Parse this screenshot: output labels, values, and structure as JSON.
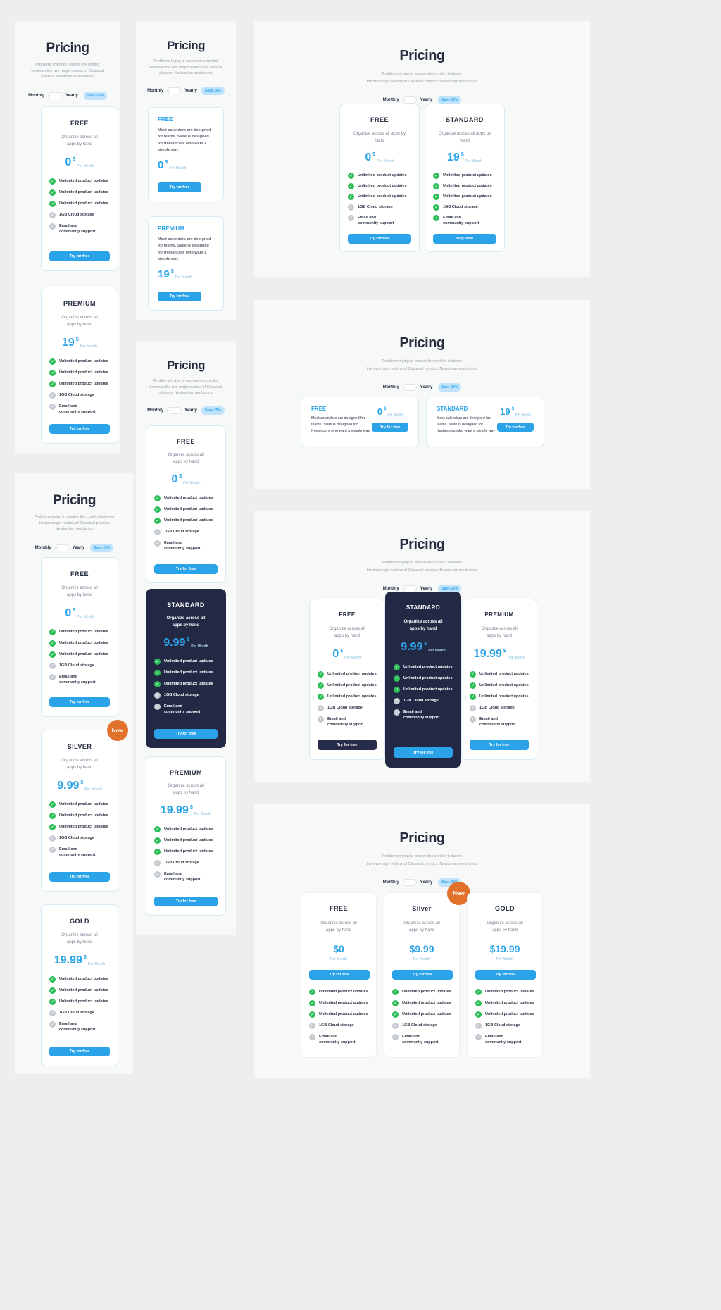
{
  "header": {
    "title": "Pricing",
    "subtitle_narrow": "Problems trying to resolve the conflict between the two major realms of Classical physics: Newtonian mechanics",
    "subtitle_wide_l1": "Problems trying to resolve the conflict between",
    "subtitle_wide_l2": "the two major realms of Classical physics: Newtonian mechanics",
    "toggle": {
      "monthly": "Monthly",
      "yearly": "Yearly",
      "save": "Save 25%"
    }
  },
  "labels": {
    "per_month": "Per Month",
    "currency": "$",
    "desc_two_line": "Organize across all apps by hand",
    "desc_one_line": "Organize across all apps by hand",
    "desc_long": "Most calendars are designed for teams. Slate is designed for freelancers who want a simple way",
    "feat_updates": "Unlimited product updates",
    "feat_storage": "1GB  Cloud storage",
    "feat_support": "Email and community support",
    "btn_try": "Try for free",
    "btn_buy": "Buy Now",
    "badge_new": "New",
    "check_icon": "check-icon"
  },
  "plans": {
    "free": "FREE",
    "standard": "STANDARD",
    "premium": "PREMIUM",
    "silver": "SILVER",
    "silver_title": "Silver",
    "gold": "GOLD",
    "price_0": "0",
    "price_19": "19",
    "price_999": "9.99",
    "price_1999": "19.99",
    "price_d0": "$0",
    "price_d999": "$9.99",
    "price_d1999": "$19.99"
  },
  "colors": {
    "accent": "#2aa3e8",
    "navy": "#232845",
    "green": "#2ebd59",
    "gray": "#c6cbd2",
    "orange": "#e2712b",
    "save_bg": "#bfe3fb"
  }
}
